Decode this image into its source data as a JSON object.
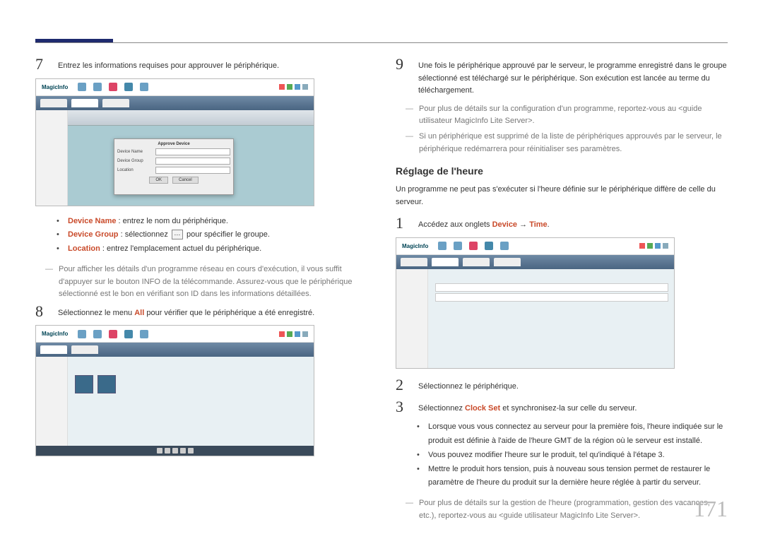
{
  "page_number": "171",
  "left": {
    "step7": {
      "text": "Entrez les informations requises pour approuver le périphérique."
    },
    "bullets": {
      "b1_label": "Device Name",
      "b1_text": " : entrez le nom du périphérique.",
      "b2_label": "Device Group",
      "b2_text_a": " : sélectionnez ",
      "b2_text_b": " pour spécifier le groupe.",
      "b3_label": "Location",
      "b3_text": " : entrez l'emplacement actuel du périphérique."
    },
    "note1": "Pour afficher les détails d'un programme réseau en cours d'exécution, il vous suffit d'appuyer sur le bouton INFO de la télécommande. Assurez-vous que le périphérique sélectionné est le bon en vérifiant son ID dans les informations détaillées.",
    "step8": {
      "text_a": "Sélectionnez le menu ",
      "emph": "All",
      "text_b": " pour vérifier que le périphérique a été enregistré."
    },
    "dialog": {
      "title": "Approve Device",
      "f1": "Device Name",
      "f2": "Device Group",
      "f3": "Location",
      "ok": "OK",
      "cancel": "Cancel"
    },
    "shot_logo": "MagicInfo"
  },
  "right": {
    "step9": {
      "text": "Une fois le périphérique approuvé par le serveur, le programme enregistré dans le groupe sélectionné est téléchargé sur le périphérique. Son exécution est lancée au terme du téléchargement."
    },
    "note1": "Pour plus de détails sur la configuration d'un programme, reportez-vous au <guide utilisateur MagicInfo Lite Server>.",
    "note2": "Si un périphérique est supprimé de la liste de périphériques approuvés par le serveur, le périphérique redémarrera pour réinitialiser ses paramètres.",
    "section_title": "Réglage de l'heure",
    "section_intro": "Un programme ne peut pas s'exécuter si l'heure définie sur le périphérique diffère de celle du serveur.",
    "step1": {
      "text_a": "Accédez aux onglets ",
      "emph1": "Device",
      "arrow": " → ",
      "emph2": "Time",
      "period": "."
    },
    "step2": {
      "text": "Sélectionnez le périphérique."
    },
    "step3": {
      "text_a": "Sélectionnez ",
      "emph": "Clock Set",
      "text_b": " et synchronisez-la sur celle du serveur."
    },
    "bullets2": {
      "b1": "Lorsque vous vous connectez au serveur pour la première fois, l'heure indiquée sur le produit est définie à l'aide de l'heure GMT de la région où le serveur est installé.",
      "b2": "Vous pouvez modifier l'heure sur le produit, tel qu'indiqué à l'étape 3.",
      "b3": "Mettre le produit hors tension, puis à nouveau sous tension permet de restaurer le paramètre de l'heure du produit sur la dernière heure réglée à partir du serveur."
    },
    "note3": "Pour plus de détails sur la gestion de l'heure (programmation, gestion des vacances, etc.), reportez-vous au <guide utilisateur MagicInfo Lite Server>."
  }
}
